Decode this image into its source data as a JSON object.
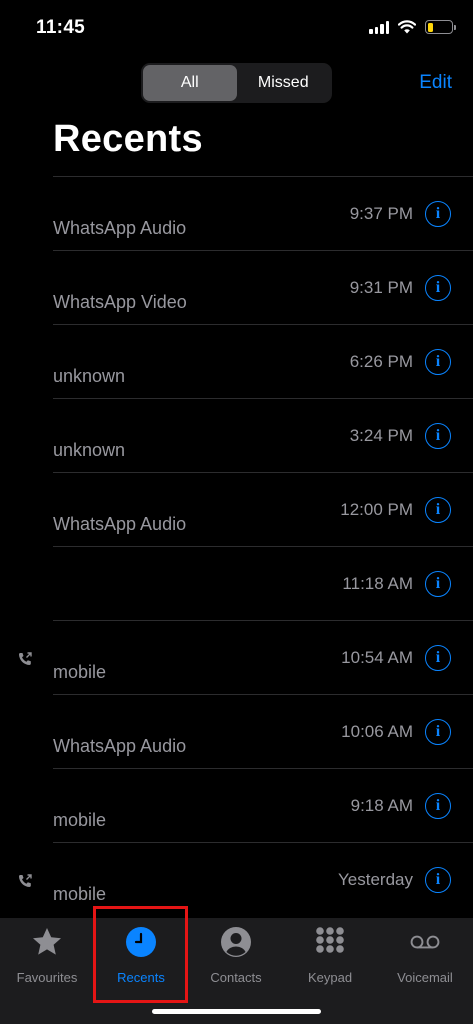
{
  "status": {
    "time": "11:45"
  },
  "header": {
    "segments": [
      "All",
      "Missed"
    ],
    "active_segment": "All",
    "edit_label": "Edit",
    "title": "Recents"
  },
  "calls": [
    {
      "name": "",
      "type": "WhatsApp Audio",
      "time": "9:37 PM",
      "outgoing": false
    },
    {
      "name": "",
      "type": "WhatsApp Video",
      "time": "9:31 PM",
      "outgoing": false
    },
    {
      "name": "",
      "type": "unknown",
      "time": "6:26 PM",
      "outgoing": false
    },
    {
      "name": "",
      "type": "unknown",
      "time": "3:24 PM",
      "outgoing": false
    },
    {
      "name": "",
      "type": "WhatsApp Audio",
      "time": "12:00 PM",
      "outgoing": false
    },
    {
      "name": "",
      "type": "",
      "time": "11:18 AM",
      "outgoing": false
    },
    {
      "name": "",
      "type": "mobile",
      "time": "10:54 AM",
      "outgoing": true
    },
    {
      "name": "",
      "type": "WhatsApp Audio",
      "time": "10:06 AM",
      "outgoing": false
    },
    {
      "name": "",
      "type": "mobile",
      "time": "9:18 AM",
      "outgoing": false
    },
    {
      "name": "",
      "type": "mobile",
      "time": "Yesterday",
      "outgoing": true
    }
  ],
  "tabs": [
    {
      "label": "Favourites",
      "icon": "star-icon"
    },
    {
      "label": "Recents",
      "icon": "clock-icon"
    },
    {
      "label": "Contacts",
      "icon": "person-icon"
    },
    {
      "label": "Keypad",
      "icon": "keypad-icon"
    },
    {
      "label": "Voicemail",
      "icon": "voicemail-icon"
    }
  ],
  "active_tab": "Recents",
  "colors": {
    "accent": "#0a84ff",
    "highlight_box": "#e51515",
    "battery": "#ffd60a"
  }
}
